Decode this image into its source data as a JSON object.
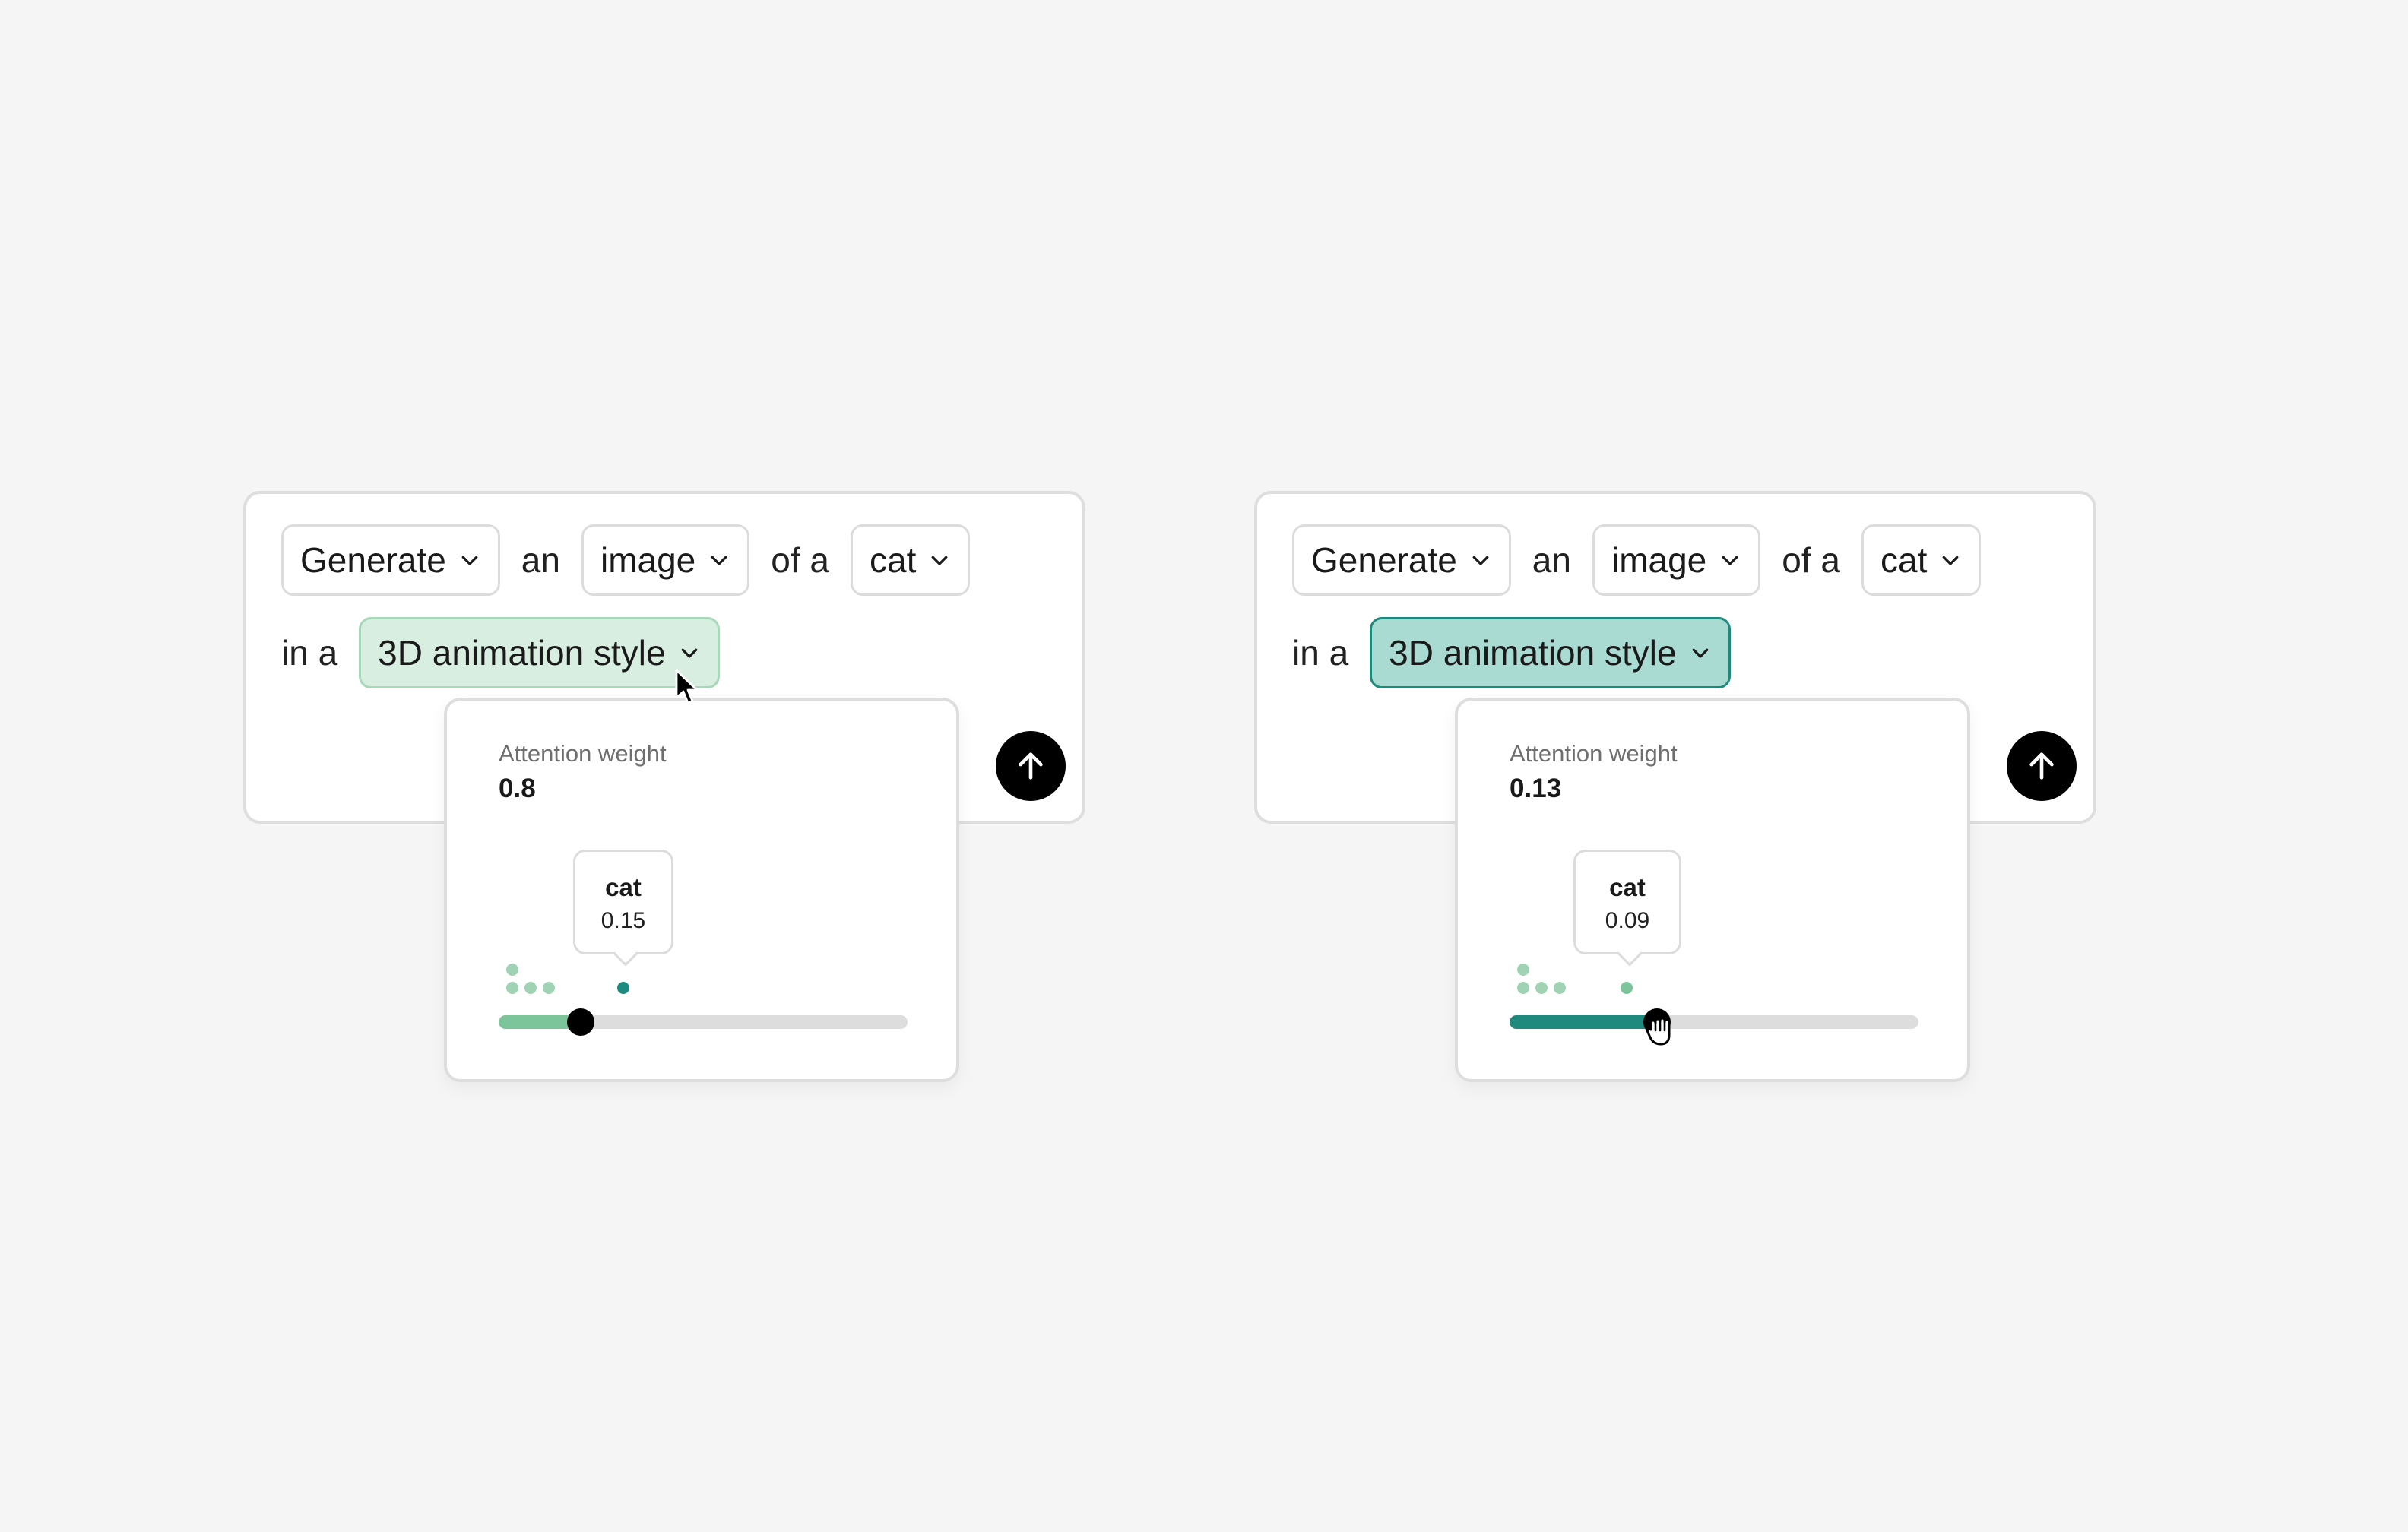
{
  "panels": [
    {
      "prompt": {
        "word1": "Generate",
        "word2": "an",
        "word3": "image",
        "word4": "of a",
        "word5": "cat",
        "word6": "in a",
        "style": "3D animation style"
      },
      "popover": {
        "label": "Attention weight",
        "value": "0.8",
        "tooltip_word": "cat",
        "tooltip_value": "0.15",
        "slider_level": 0.2
      },
      "colors": {
        "chip_bg": "#d8eee0",
        "fill": "#7cc49a",
        "active_dot": "#1e8a7d"
      },
      "icons": [
        "chevron-down-icon",
        "arrow-up-icon",
        "arrow-cursor-icon"
      ]
    },
    {
      "prompt": {
        "word1": "Generate",
        "word2": "an",
        "word3": "image",
        "word4": "of a",
        "word5": "cat",
        "word6": "in a",
        "style": "3D animation style"
      },
      "popover": {
        "label": "Attention weight",
        "value": "0.13",
        "tooltip_word": "cat",
        "tooltip_value": "0.09",
        "slider_level": 0.36
      },
      "colors": {
        "chip_bg": "#a9dbd3",
        "fill": "#1e8a7d",
        "active_dot": "#7cc49a"
      },
      "icons": [
        "chevron-down-icon",
        "arrow-up-icon",
        "hand-grab-cursor-icon"
      ]
    }
  ]
}
